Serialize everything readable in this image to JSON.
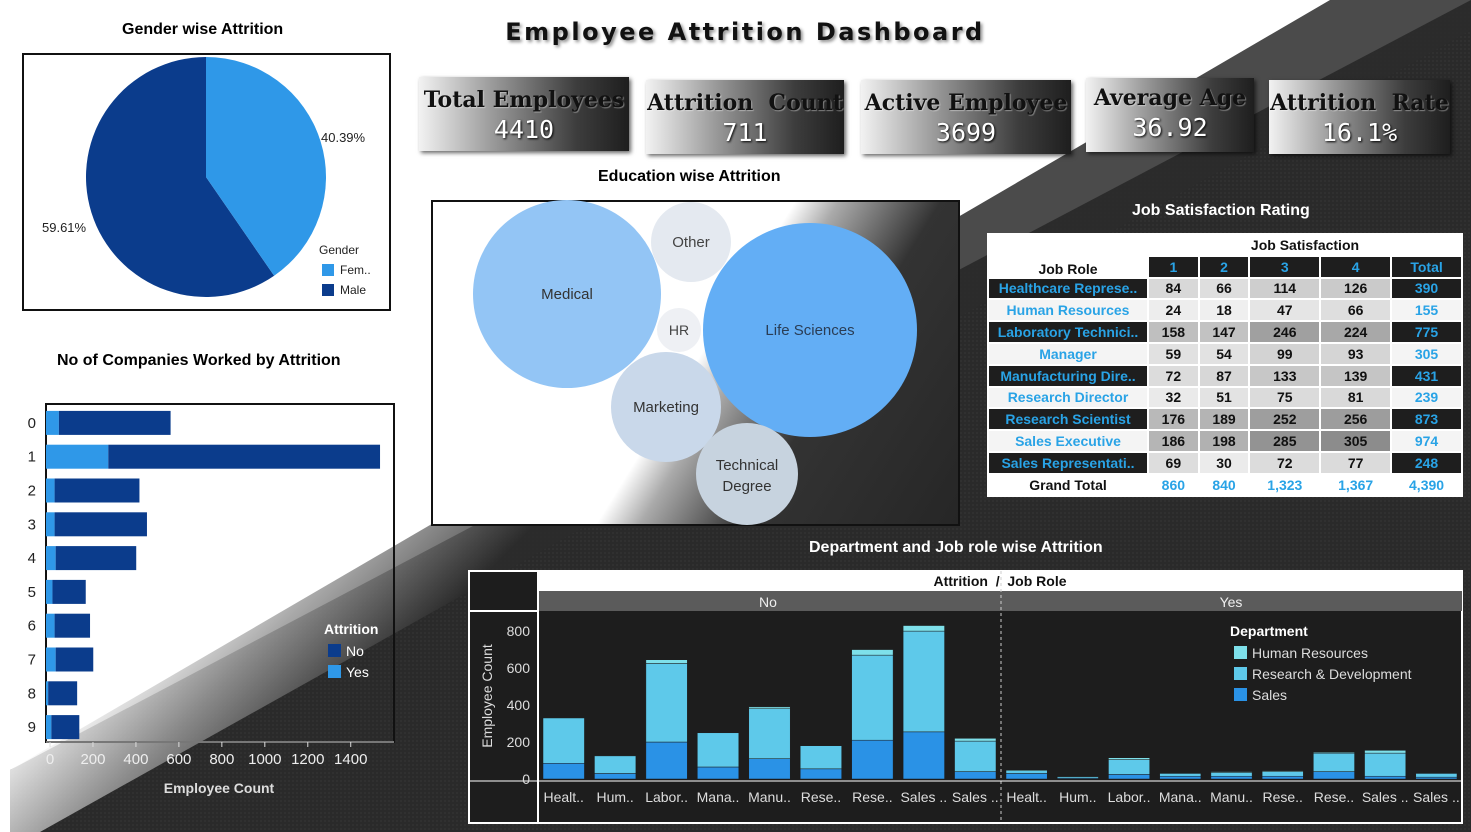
{
  "title": "Employee Attrition Dashboard",
  "colors": {
    "male": "#0b3c8c",
    "female": "#2f98e8",
    "no": "#0b3c8c",
    "yes": "#2f98e8",
    "hr": "#7ee0ea",
    "rnd": "#5ec9ea",
    "sales": "#2a92e6",
    "header_blue": "#29a3e6"
  },
  "kpis": [
    {
      "label": "Total Employees",
      "value": "4410"
    },
    {
      "label": "Attrition  Count",
      "value": "711"
    },
    {
      "label": "Active Employee",
      "value": "3699"
    },
    {
      "label": "Average Age",
      "value": "36.92"
    },
    {
      "label": "Attrition  Rate",
      "value": "16.1%"
    }
  ],
  "gender": {
    "title": "Gender wise Attrition",
    "legend_title": "Gender",
    "slices": [
      {
        "name": "Fem..",
        "value": 40.39,
        "label": "40.39%"
      },
      {
        "name": "Male",
        "value": 59.61,
        "label": "59.61%"
      }
    ]
  },
  "companies": {
    "title": "No of Companies Worked by Attrition",
    "xlabel": "Employee Count",
    "legend_title": "Attrition",
    "legend": [
      "No",
      "Yes"
    ],
    "categories": [
      "0",
      "1",
      "2",
      "3",
      "4",
      "5",
      "6",
      "7",
      "8",
      "9"
    ],
    "yes": [
      60,
      290,
      40,
      40,
      45,
      30,
      40,
      45,
      10,
      25
    ],
    "no": [
      520,
      1265,
      395,
      430,
      375,
      155,
      165,
      175,
      135,
      130
    ],
    "ticks": [
      "0",
      "200",
      "400",
      "600",
      "800",
      "1000",
      "1200",
      "1400"
    ],
    "xmax": 1620
  },
  "education": {
    "title": "Education wise Attrition",
    "bubbles": [
      "Medical",
      "Other",
      "HR",
      "Life Sciences",
      "Marketing",
      "Technical",
      "Degree"
    ]
  },
  "satisfaction": {
    "title": "Job Satisfaction Rating",
    "header_group": "Job Satisfaction",
    "col_role": "Job Role",
    "cols": [
      "1",
      "2",
      "3",
      "4",
      "Total"
    ],
    "rows": [
      {
        "role": "Healthcare Represe..",
        "v": [
          "84",
          "66",
          "114",
          "126",
          "390"
        ]
      },
      {
        "role": "Human Resources",
        "v": [
          "24",
          "18",
          "47",
          "66",
          "155"
        ]
      },
      {
        "role": "Laboratory Technici..",
        "v": [
          "158",
          "147",
          "246",
          "224",
          "775"
        ]
      },
      {
        "role": "Manager",
        "v": [
          "59",
          "54",
          "99",
          "93",
          "305"
        ]
      },
      {
        "role": "Manufacturing Dire..",
        "v": [
          "72",
          "87",
          "133",
          "139",
          "431"
        ]
      },
      {
        "role": "Research Director",
        "v": [
          "32",
          "51",
          "75",
          "81",
          "239"
        ]
      },
      {
        "role": "Research Scientist",
        "v": [
          "176",
          "189",
          "252",
          "256",
          "873"
        ]
      },
      {
        "role": "Sales Executive",
        "v": [
          "186",
          "198",
          "285",
          "305",
          "974"
        ]
      },
      {
        "role": "Sales Representati..",
        "v": [
          "69",
          "30",
          "72",
          "77",
          "248"
        ]
      }
    ],
    "grand_label": "Grand Total",
    "grand": [
      "860",
      "840",
      "1,323",
      "1,367",
      "4,390"
    ]
  },
  "chart_data": {
    "type": "bar",
    "title": "Department and Job role wise Attrition",
    "header": "Attrition  /  Job Role",
    "ylabel": "Employee Count",
    "yticks": [
      "800",
      "600",
      "400",
      "200",
      "0"
    ],
    "ylim": [
      0,
      860
    ],
    "panels": [
      {
        "name": "No",
        "categories": [
          "Healt..",
          "Hum..",
          "Labor..",
          "Mana..",
          "Manu..",
          "Rese..",
          "Rese..",
          "Sales ..",
          "Sales .."
        ],
        "series": {
          "Sales": [
            85,
            30,
            200,
            65,
            110,
            55,
            210,
            255,
            40
          ],
          "Research & Development": [
            245,
            95,
            425,
            185,
            270,
            125,
            460,
            545,
            165
          ],
          "Human Resources": [
            0,
            0,
            20,
            0,
            10,
            0,
            30,
            30,
            15
          ]
        }
      },
      {
        "name": "Yes",
        "categories": [
          "Healt..",
          "Hum..",
          "Labor..",
          "Mana..",
          "Manu..",
          "Rese..",
          "Rese..",
          "Sales ..",
          "Sales .."
        ],
        "series": {
          "Sales": [
            30,
            5,
            25,
            15,
            15,
            15,
            40,
            15,
            10
          ],
          "Research & Development": [
            15,
            8,
            80,
            15,
            20,
            25,
            100,
            125,
            20
          ],
          "Human Resources": [
            5,
            2,
            10,
            0,
            5,
            5,
            5,
            15,
            0
          ]
        }
      }
    ],
    "legend_title": "Department",
    "legend": [
      "Human Resources",
      "Research & Development",
      "Sales"
    ]
  }
}
